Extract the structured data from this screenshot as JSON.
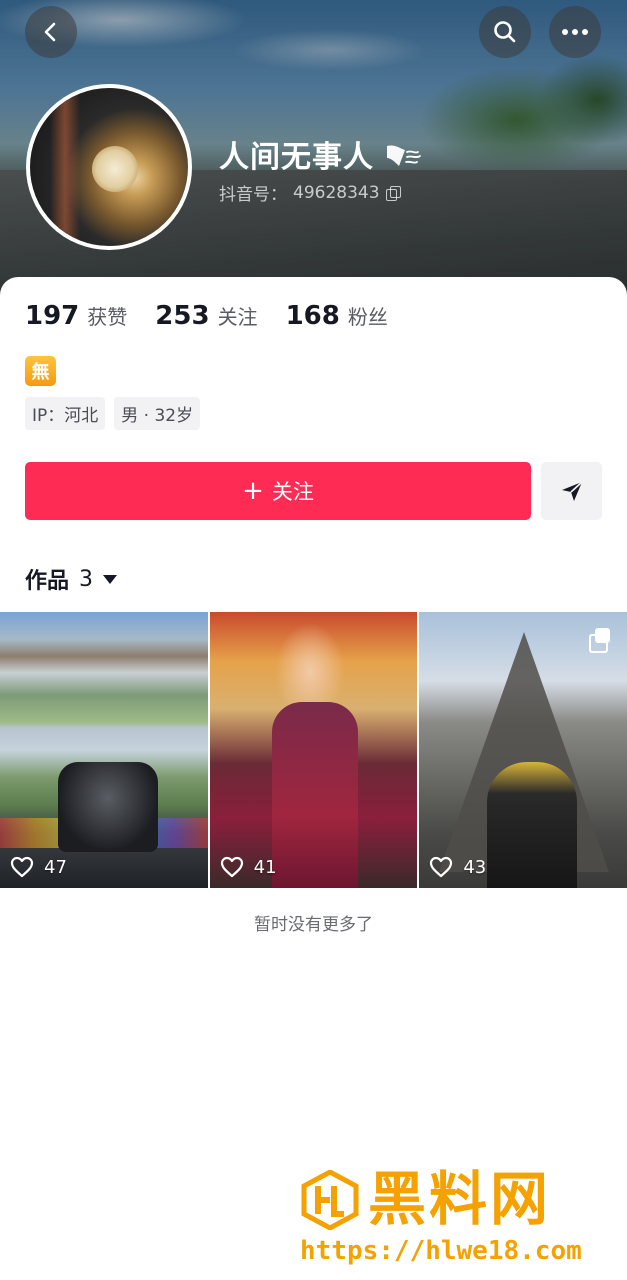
{
  "header": {
    "username": "人间无事人",
    "douyin_id_label": "抖音号：",
    "douyin_id": "49628343"
  },
  "stats": [
    {
      "value": "197",
      "label": "获赞"
    },
    {
      "value": "253",
      "label": "关注"
    },
    {
      "value": "168",
      "label": "粉丝"
    }
  ],
  "bio_emoji": "無",
  "tags": [
    {
      "label": "IP：河北"
    },
    {
      "label": "男 · 32岁"
    }
  ],
  "actions": {
    "follow_plus": "+",
    "follow_label": "关注"
  },
  "works": {
    "title": "作品",
    "count": "3",
    "items": [
      {
        "likes": "47",
        "multi": false
      },
      {
        "likes": "41",
        "multi": false
      },
      {
        "likes": "43",
        "multi": true
      }
    ],
    "end_text": "暂时没有更多了"
  },
  "watermark": {
    "title": "黑料网",
    "url": "https://hlwe18.com"
  },
  "colors": {
    "accent": "#fe2c55",
    "watermark": "#f5a100"
  },
  "icons": [
    "back-icon",
    "search-icon",
    "more-icon",
    "copy-icon",
    "send-icon",
    "heart-icon",
    "multi-image-icon",
    "caret-down-icon"
  ]
}
